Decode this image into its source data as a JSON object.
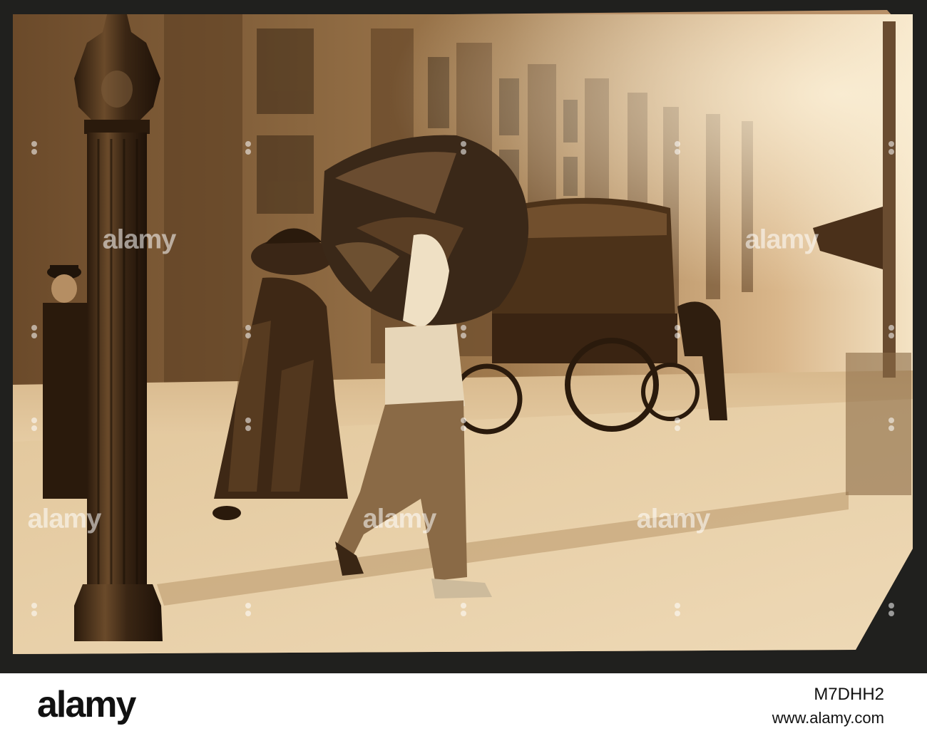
{
  "photo": {
    "tone": "sepia",
    "colors": {
      "border": "#20201e",
      "paper": "#e9cfa6",
      "highlight": "#f3dfbc",
      "shadow": "#3a2614"
    }
  },
  "watermark": {
    "text": "alamy"
  },
  "footer": {
    "logo": "alamy",
    "image_id": "M7DHH2",
    "url": "www.alamy.com"
  }
}
